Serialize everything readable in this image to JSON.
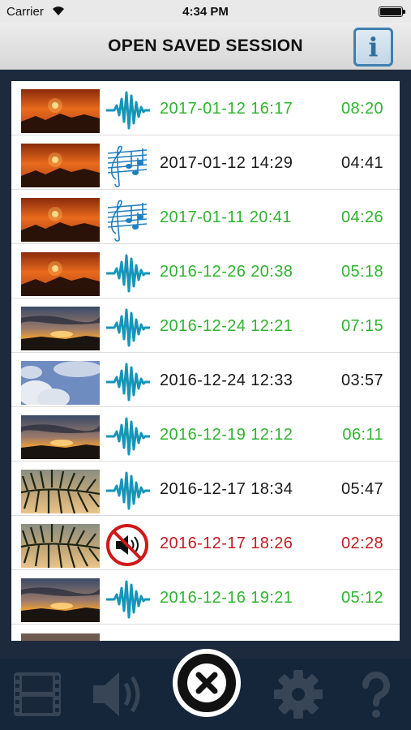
{
  "status_bar": {
    "carrier": "Carrier",
    "time": "4:34 PM"
  },
  "header": {
    "title": "OPEN SAVED SESSION",
    "info_icon": "info-icon"
  },
  "colors": {
    "green": "#2fb42f",
    "black": "#1a1a1a",
    "red": "#c21c24",
    "accent": "#3d7fb0"
  },
  "sessions": [
    {
      "thumbnail": "sunset-thumbnail",
      "kind": "waveform-icon",
      "datetime": "2017-01-12 16:17",
      "duration": "08:20",
      "status": "green"
    },
    {
      "thumbnail": "sunset-thumbnail",
      "kind": "music-notes-icon",
      "datetime": "2017-01-12 14:29",
      "duration": "04:41",
      "status": "black"
    },
    {
      "thumbnail": "sunset-thumbnail",
      "kind": "music-notes-icon",
      "datetime": "2017-01-11 20:41",
      "duration": "04:26",
      "status": "green"
    },
    {
      "thumbnail": "sunset-thumbnail",
      "kind": "waveform-icon",
      "datetime": "2016-12-26 20:38",
      "duration": "05:18",
      "status": "green"
    },
    {
      "thumbnail": "dusk-clouds-thumbnail",
      "kind": "waveform-icon",
      "datetime": "2016-12-24 12:21",
      "duration": "07:15",
      "status": "green"
    },
    {
      "thumbnail": "blue-sky-clouds-thumbnail",
      "kind": "waveform-icon",
      "datetime": "2016-12-24 12:33",
      "duration": "03:57",
      "status": "black"
    },
    {
      "thumbnail": "dusk-clouds-thumbnail",
      "kind": "waveform-icon",
      "datetime": "2016-12-19 12:12",
      "duration": "06:11",
      "status": "green"
    },
    {
      "thumbnail": "palm-frond-thumbnail",
      "kind": "waveform-icon",
      "datetime": "2016-12-17 18:34",
      "duration": "05:47",
      "status": "black"
    },
    {
      "thumbnail": "palm-frond-thumbnail",
      "kind": "muted-speaker-icon",
      "datetime": "2016-12-17 18:26",
      "duration": "02:28",
      "status": "red"
    },
    {
      "thumbnail": "dusk-clouds-thumbnail",
      "kind": "waveform-icon",
      "datetime": "2016-12-16 19:21",
      "duration": "05:12",
      "status": "green"
    }
  ],
  "tab_bar": {
    "tabs": [
      "film-strip-icon",
      "speaker-icon",
      "sessions-icon",
      "gear-icon",
      "help-icon"
    ],
    "close_icon": "close-icon"
  }
}
